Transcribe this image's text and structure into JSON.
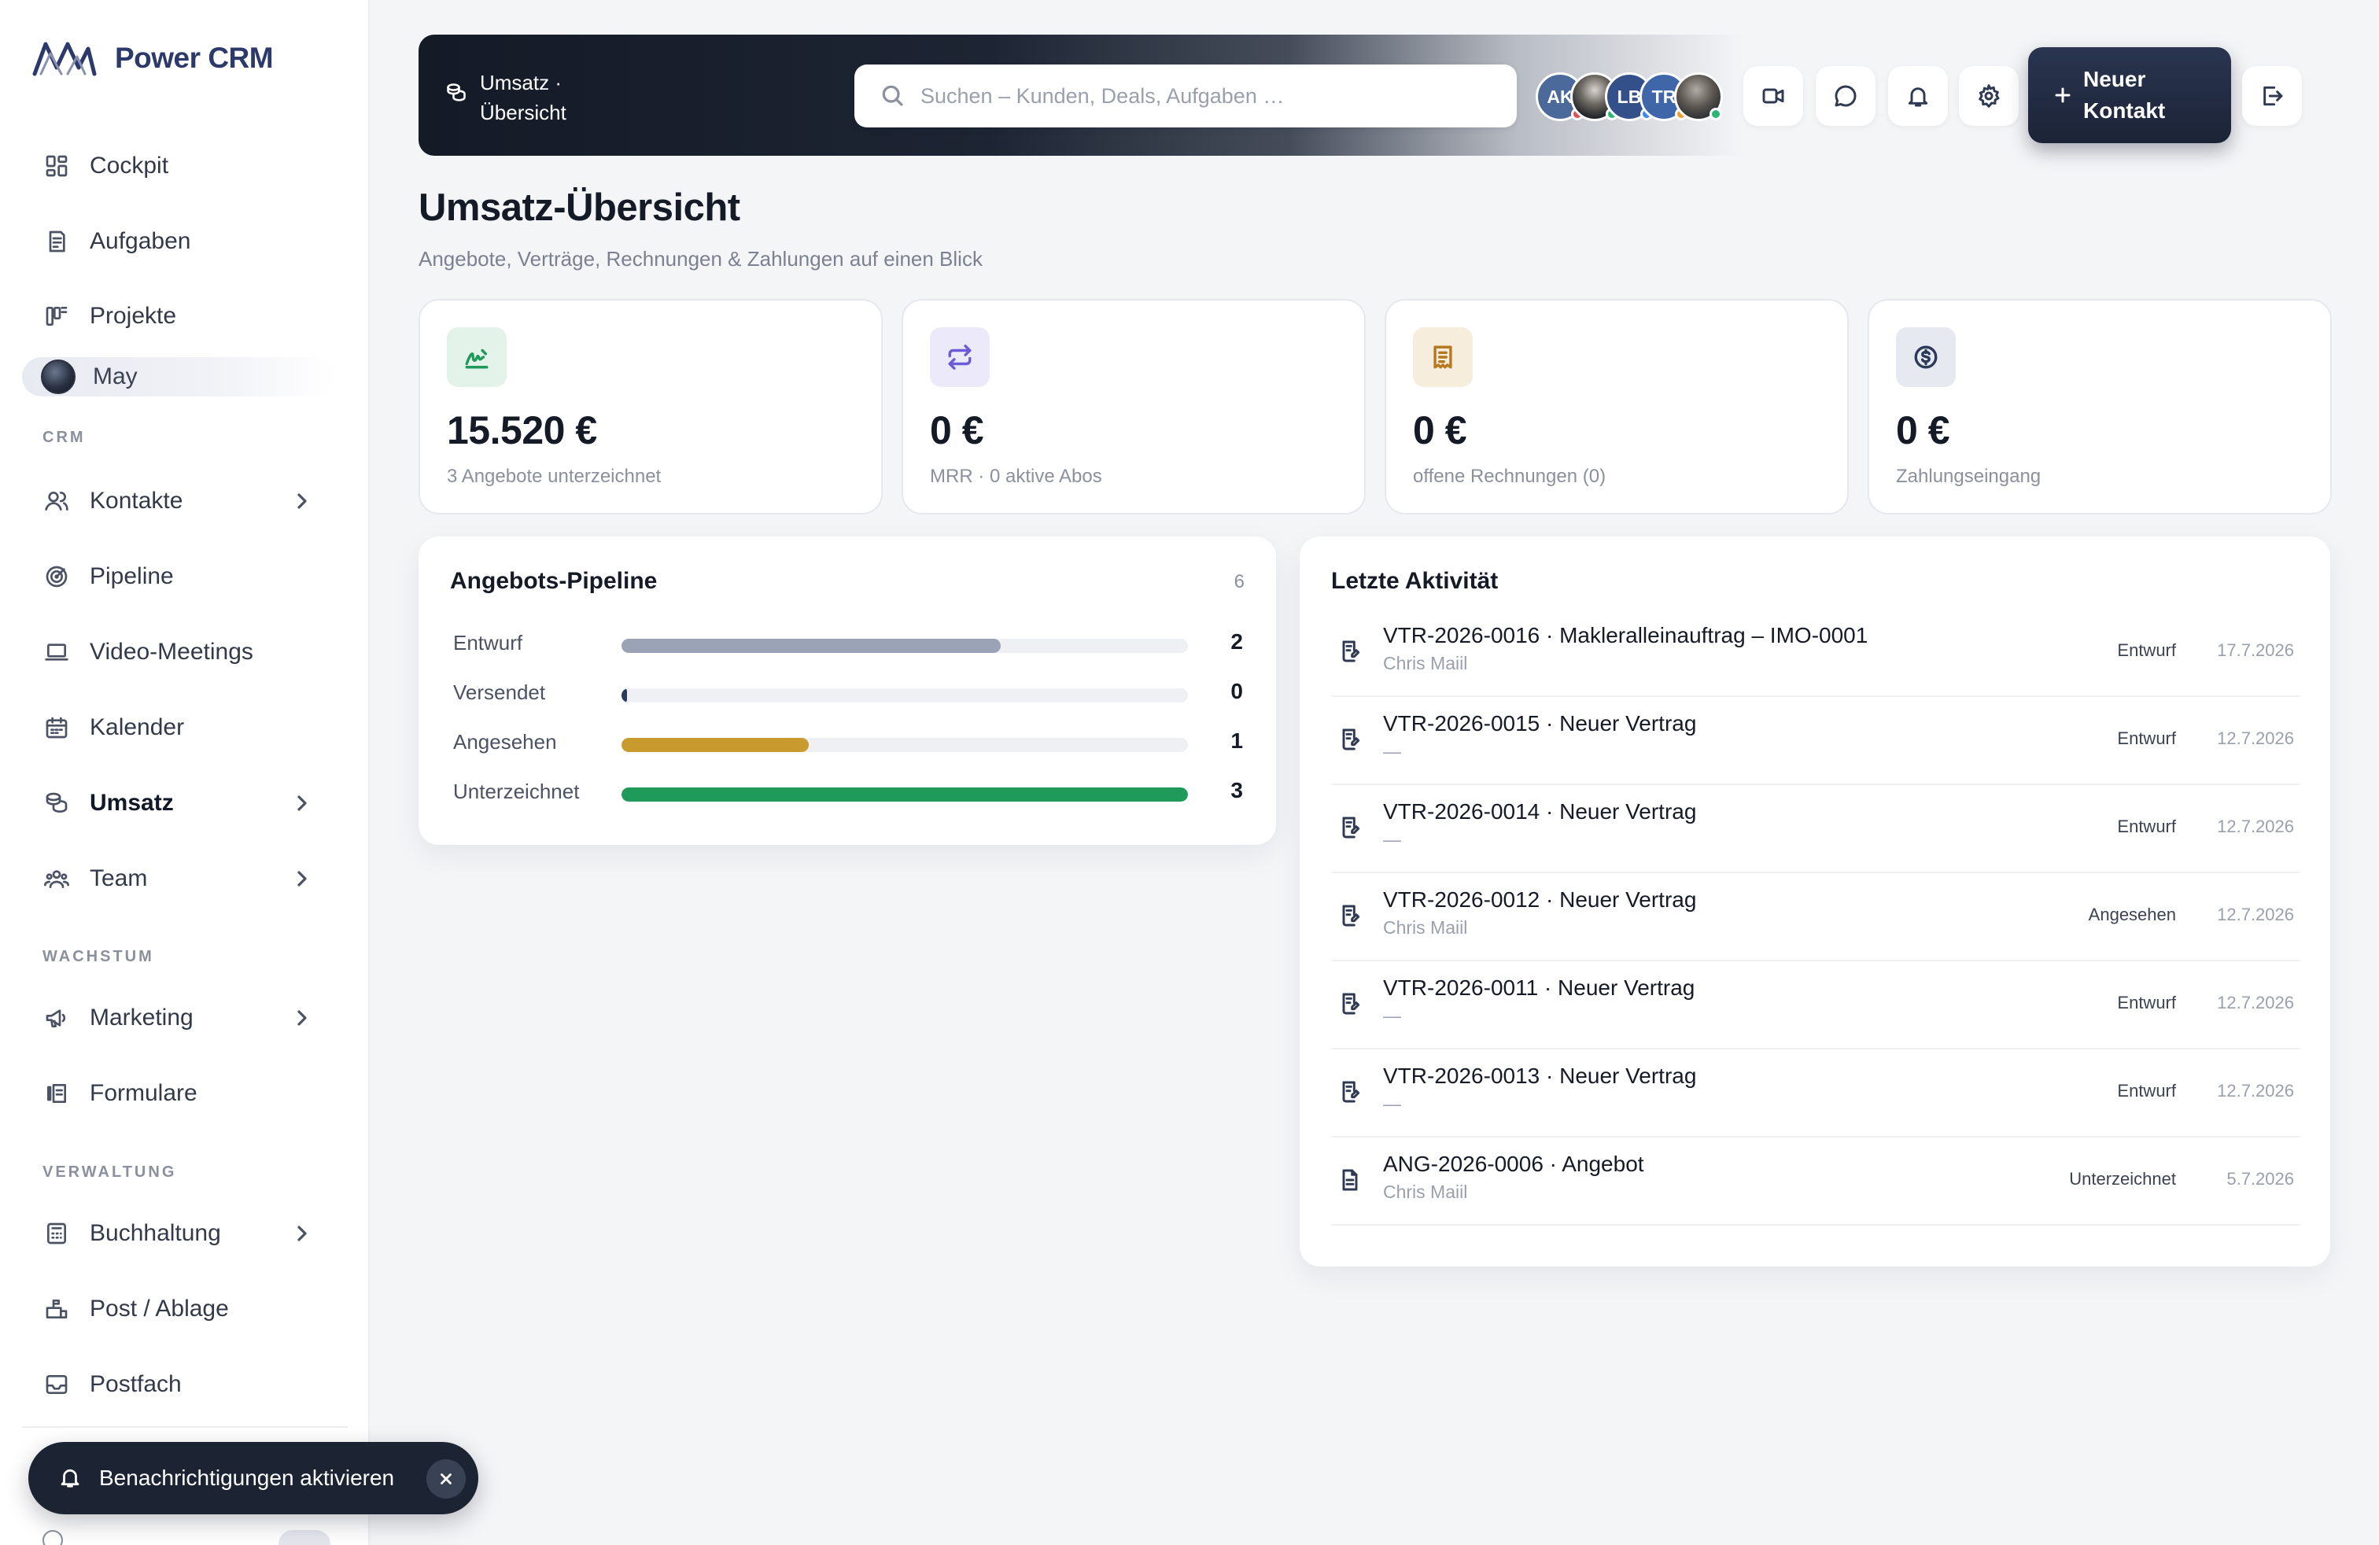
{
  "app": {
    "name": "Power CRM"
  },
  "sidebar": {
    "items_top": [
      {
        "label": "Cockpit",
        "icon": "dashboard-icon"
      },
      {
        "label": "Aufgaben",
        "icon": "tasks-icon"
      },
      {
        "label": "Projekte",
        "icon": "projects-icon"
      }
    ],
    "user": {
      "name": "May"
    },
    "sections": {
      "crm": "CRM",
      "growth": "WACHSTUM",
      "admin": "VERWALTUNG"
    },
    "crm_items": [
      {
        "label": "Kontakte",
        "icon": "contacts-icon",
        "has_children": true
      },
      {
        "label": "Pipeline",
        "icon": "target-icon",
        "has_children": false
      },
      {
        "label": "Video-Meetings",
        "icon": "laptop-icon",
        "has_children": false
      },
      {
        "label": "Kalender",
        "icon": "calendar-icon",
        "has_children": false
      },
      {
        "label": "Umsatz",
        "icon": "coins-icon",
        "has_children": true,
        "active": true
      },
      {
        "label": "Team",
        "icon": "team-icon",
        "has_children": true
      }
    ],
    "growth_items": [
      {
        "label": "Marketing",
        "icon": "megaphone-icon",
        "has_children": true
      },
      {
        "label": "Formulare",
        "icon": "forms-icon",
        "has_children": false
      }
    ],
    "admin_items": [
      {
        "label": "Buchhaltung",
        "icon": "calculator-icon",
        "has_children": true
      },
      {
        "label": "Post / Ablage",
        "icon": "mailbox-icon",
        "has_children": false
      },
      {
        "label": "Postfach",
        "icon": "inbox-icon",
        "has_children": false
      }
    ],
    "toast": {
      "text": "Benachrichtigungen aktivieren"
    }
  },
  "topbar": {
    "breadcrumb": "Umsatz · Übersicht",
    "search_placeholder": "Suchen – Kunden, Deals, Aufgaben …",
    "avatars": [
      {
        "initials": "AK",
        "color": "#4b6a9b",
        "status": "#e05252"
      },
      {
        "initials": "",
        "color": "#2a2f3a",
        "status": "#2bb673",
        "photo": true
      },
      {
        "initials": "LB",
        "color": "#33508a",
        "status": "#3d8ae8"
      },
      {
        "initials": "TR",
        "color": "#3f66a8",
        "status": "#f0a030"
      },
      {
        "initials": "",
        "color": "#4a4f58",
        "status": "#2bb673",
        "photo": true
      }
    ],
    "new_contact_label": "Neuer Kontakt"
  },
  "page": {
    "title": "Umsatz-Übersicht",
    "subtitle": "Angebote, Verträge, Rechnungen & Zahlungen auf einen Blick"
  },
  "kpis": [
    {
      "value": "15.520 €",
      "label": "3 Angebote unterzeichnet",
      "icon": "signature-icon",
      "bg": "#e3f3ea",
      "fg": "#1f9a5a"
    },
    {
      "value": "0 €",
      "label": "MRR · 0 aktive Abos",
      "icon": "repeat-icon",
      "bg": "#ece9fb",
      "fg": "#6c5bd6"
    },
    {
      "value": "0 €",
      "label": "offene Rechnungen (0)",
      "icon": "receipt-icon",
      "bg": "#f7eddc",
      "fg": "#b7791f"
    },
    {
      "value": "0 €",
      "label": "Zahlungseingang",
      "icon": "dollar-circle-icon",
      "bg": "#e6e9ef",
      "fg": "#2c3a5a"
    }
  ],
  "pipeline": {
    "title": "Angebots-Pipeline",
    "total": "6",
    "rows": [
      {
        "label": "Entwurf",
        "value": 2,
        "fraction": 0.67,
        "color": "#9aa3b5"
      },
      {
        "label": "Versendet",
        "value": 0,
        "fraction": 0.01,
        "color": "#2c3a5a"
      },
      {
        "label": "Angesehen",
        "value": 1,
        "fraction": 0.33,
        "color": "#c99a2e"
      },
      {
        "label": "Unterzeichnet",
        "value": 3,
        "fraction": 1.0,
        "color": "#1f9a5a"
      }
    ]
  },
  "activity": {
    "title": "Letzte Aktivität",
    "items": [
      {
        "title": "VTR-2026-0016 · Makleralleinauftrag – IMO-0001",
        "sub": "Chris Maiil",
        "status": "Entwurf",
        "date": "17.7.2026",
        "icon": "contract-icon"
      },
      {
        "title": "VTR-2026-0015 · Neuer Vertrag",
        "sub": "—",
        "status": "Entwurf",
        "date": "12.7.2026",
        "icon": "contract-icon"
      },
      {
        "title": "VTR-2026-0014 · Neuer Vertrag",
        "sub": "—",
        "status": "Entwurf",
        "date": "12.7.2026",
        "icon": "contract-icon"
      },
      {
        "title": "VTR-2026-0012 · Neuer Vertrag",
        "sub": "Chris Maiil",
        "status": "Angesehen",
        "date": "12.7.2026",
        "icon": "contract-icon"
      },
      {
        "title": "VTR-2026-0011 · Neuer Vertrag",
        "sub": "—",
        "status": "Entwurf",
        "date": "12.7.2026",
        "icon": "contract-icon"
      },
      {
        "title": "VTR-2026-0013 · Neuer Vertrag",
        "sub": "—",
        "status": "Entwurf",
        "date": "12.7.2026",
        "icon": "contract-icon"
      },
      {
        "title": "ANG-2026-0006 · Angebot",
        "sub": "Chris Maiil",
        "status": "Unterzeichnet",
        "date": "5.7.2026",
        "icon": "document-icon"
      }
    ]
  }
}
